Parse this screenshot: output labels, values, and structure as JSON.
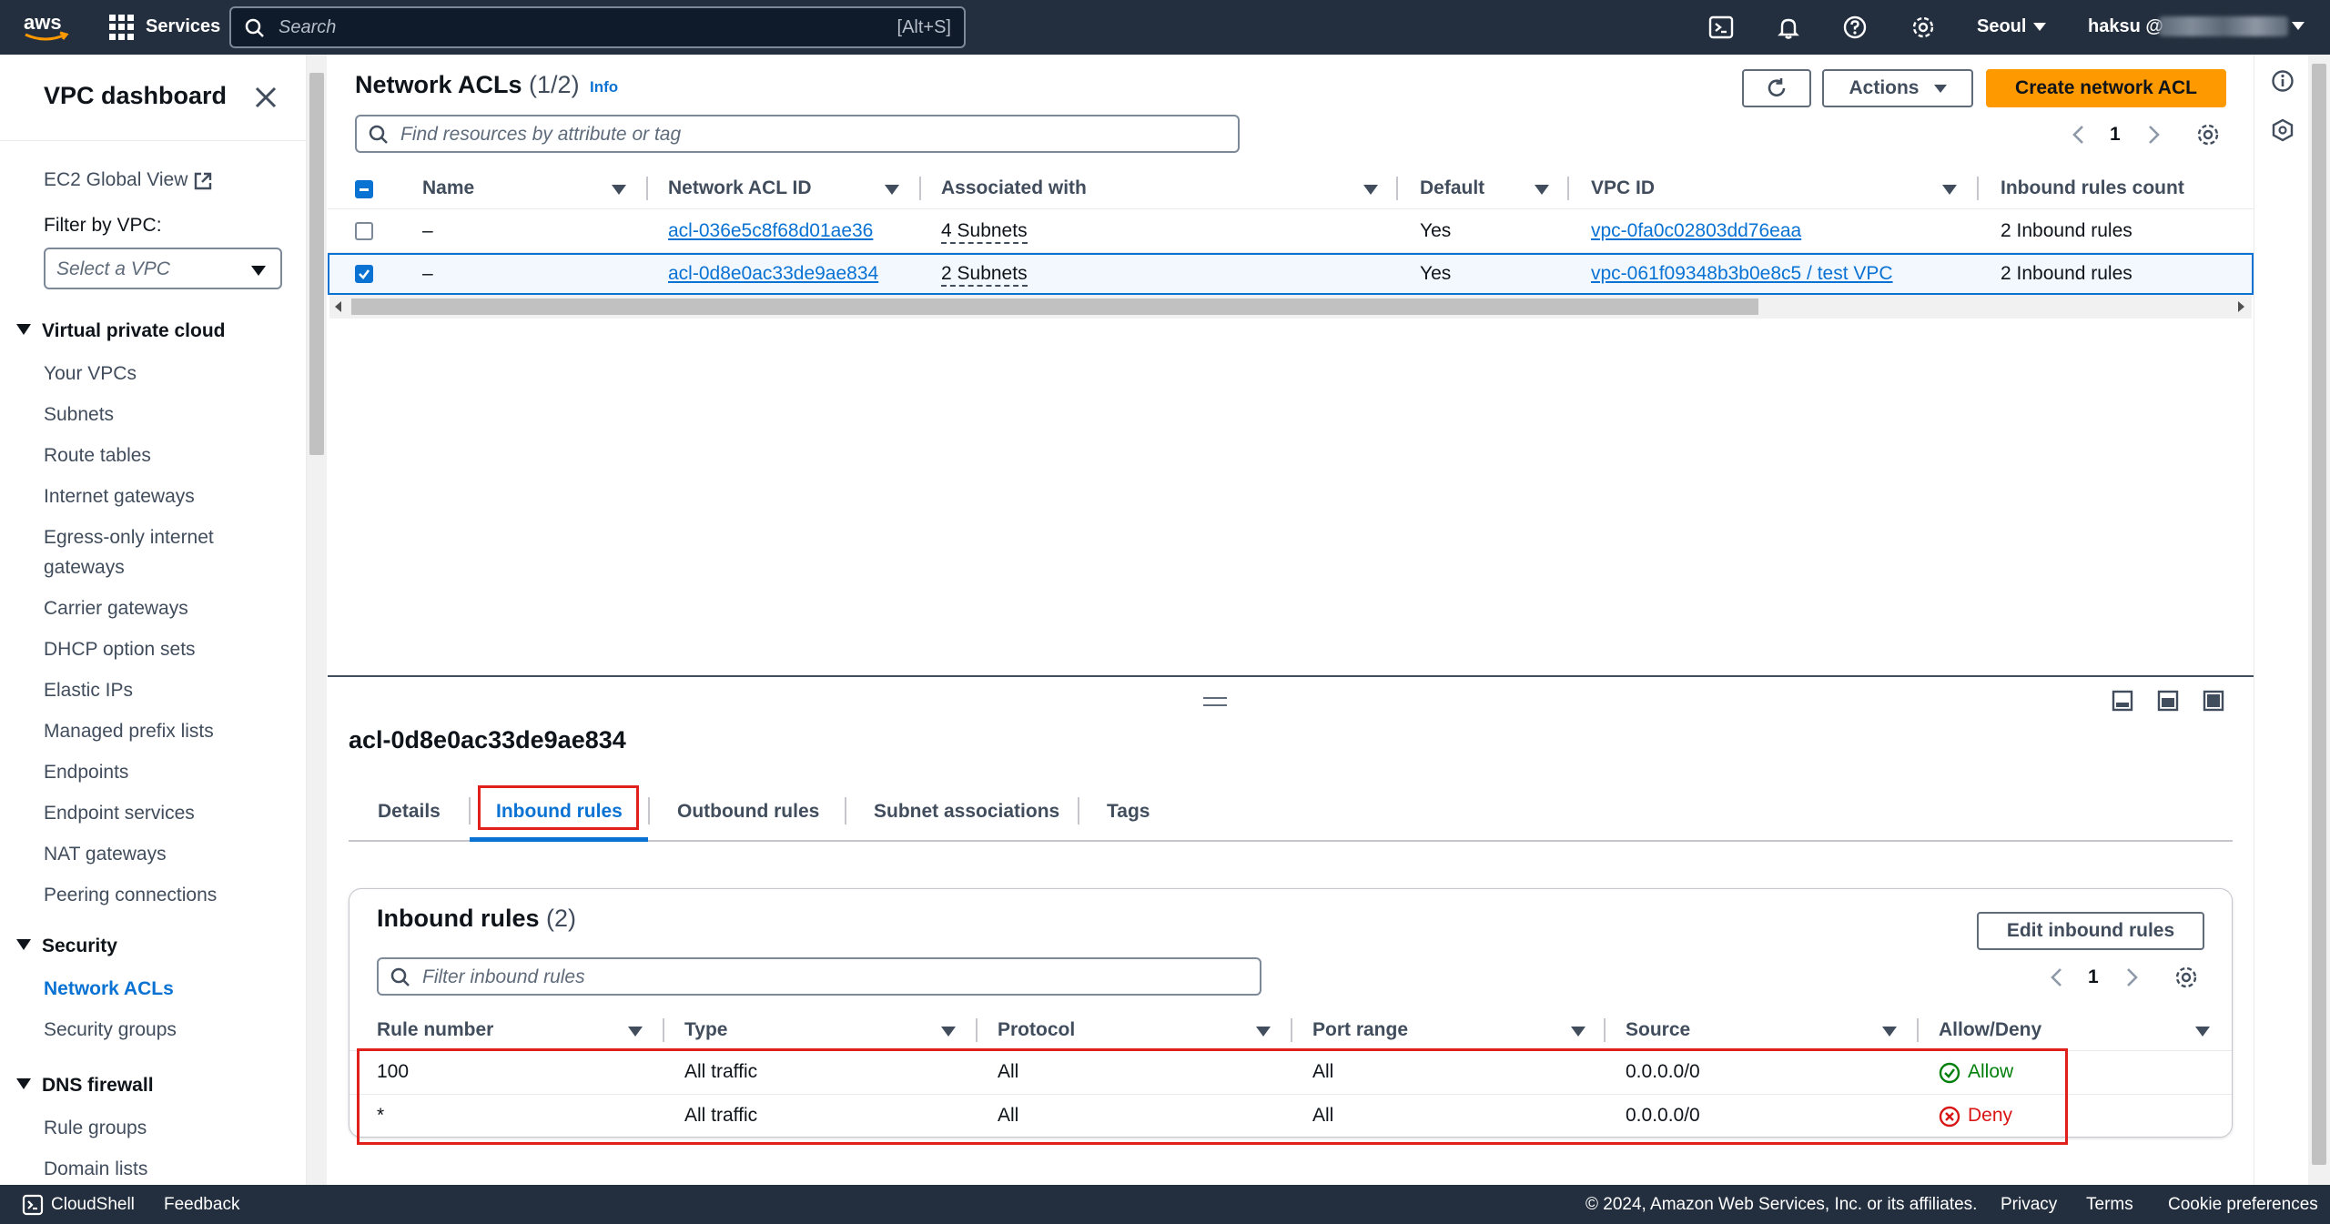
{
  "topnav": {
    "brand": "aws",
    "services_label": "Services",
    "search_placeholder": "Search",
    "search_shortcut": "[Alt+S]",
    "region": "Seoul",
    "user": "haksu @"
  },
  "sidebar": {
    "title": "VPC dashboard",
    "ec2_global_view": "EC2 Global View",
    "filter_label": "Filter by VPC:",
    "vpc_select_placeholder": "Select a VPC",
    "sections": [
      {
        "label": "Virtual private cloud",
        "items": [
          "Your VPCs",
          "Subnets",
          "Route tables",
          "Internet gateways",
          "Egress-only internet gateways",
          "Carrier gateways",
          "DHCP option sets",
          "Elastic IPs",
          "Managed prefix lists",
          "Endpoints",
          "Endpoint services",
          "NAT gateways",
          "Peering connections"
        ]
      },
      {
        "label": "Security",
        "items": [
          "Network ACLs",
          "Security groups"
        ]
      },
      {
        "label": "DNS firewall",
        "items": [
          "Rule groups",
          "Domain lists"
        ]
      }
    ],
    "active_item": "Network ACLs"
  },
  "acl_list": {
    "title": "Network ACLs",
    "count": "(1/2)",
    "info": "Info",
    "refresh_label": "Refresh",
    "actions_label": "Actions",
    "create_label": "Create network ACL",
    "search_placeholder": "Find resources by attribute or tag",
    "page": "1",
    "columns": [
      "Name",
      "Network ACL ID",
      "Associated with",
      "Default",
      "VPC ID",
      "Inbound rules count"
    ],
    "rows": [
      {
        "selected": false,
        "name": "–",
        "id": "acl-036e5c8f68d01ae36",
        "assoc": "4 Subnets",
        "default": "Yes",
        "vpc": "vpc-0fa0c02803dd76eaa",
        "inbound": "2 Inbound rules"
      },
      {
        "selected": true,
        "name": "–",
        "id": "acl-0d8e0ac33de9ae834",
        "assoc": "2 Subnets",
        "default": "Yes",
        "vpc": "vpc-061f09348b3b0e8c5 / test VPC",
        "inbound": "2 Inbound rules"
      }
    ]
  },
  "detail": {
    "title": "acl-0d8e0ac33de9ae834",
    "tabs": [
      "Details",
      "Inbound rules",
      "Outbound rules",
      "Subnet associations",
      "Tags"
    ],
    "active_tab": "Inbound rules",
    "inbound": {
      "title": "Inbound rules",
      "count": "(2)",
      "edit_label": "Edit inbound rules",
      "filter_placeholder": "Filter inbound rules",
      "page": "1",
      "columns": [
        "Rule number",
        "Type",
        "Protocol",
        "Port range",
        "Source",
        "Allow/Deny"
      ],
      "rows": [
        {
          "rule": "100",
          "type": "All traffic",
          "protocol": "All",
          "port": "All",
          "source": "0.0.0.0/0",
          "action": "Allow"
        },
        {
          "rule": "*",
          "type": "All traffic",
          "protocol": "All",
          "port": "All",
          "source": "0.0.0.0/0",
          "action": "Deny"
        }
      ]
    }
  },
  "footer": {
    "cloudshell": "CloudShell",
    "feedback": "Feedback",
    "copyright": "© 2024, Amazon Web Services, Inc. or its affiliates.",
    "privacy": "Privacy",
    "terms": "Terms",
    "cookies": "Cookie preferences"
  },
  "colors": {
    "nav_bg": "#232f3e",
    "link": "#0972d3",
    "primary": "#ff9900",
    "allow": "#037f0c",
    "deny": "#d91515",
    "highlight": "#e0201b"
  }
}
